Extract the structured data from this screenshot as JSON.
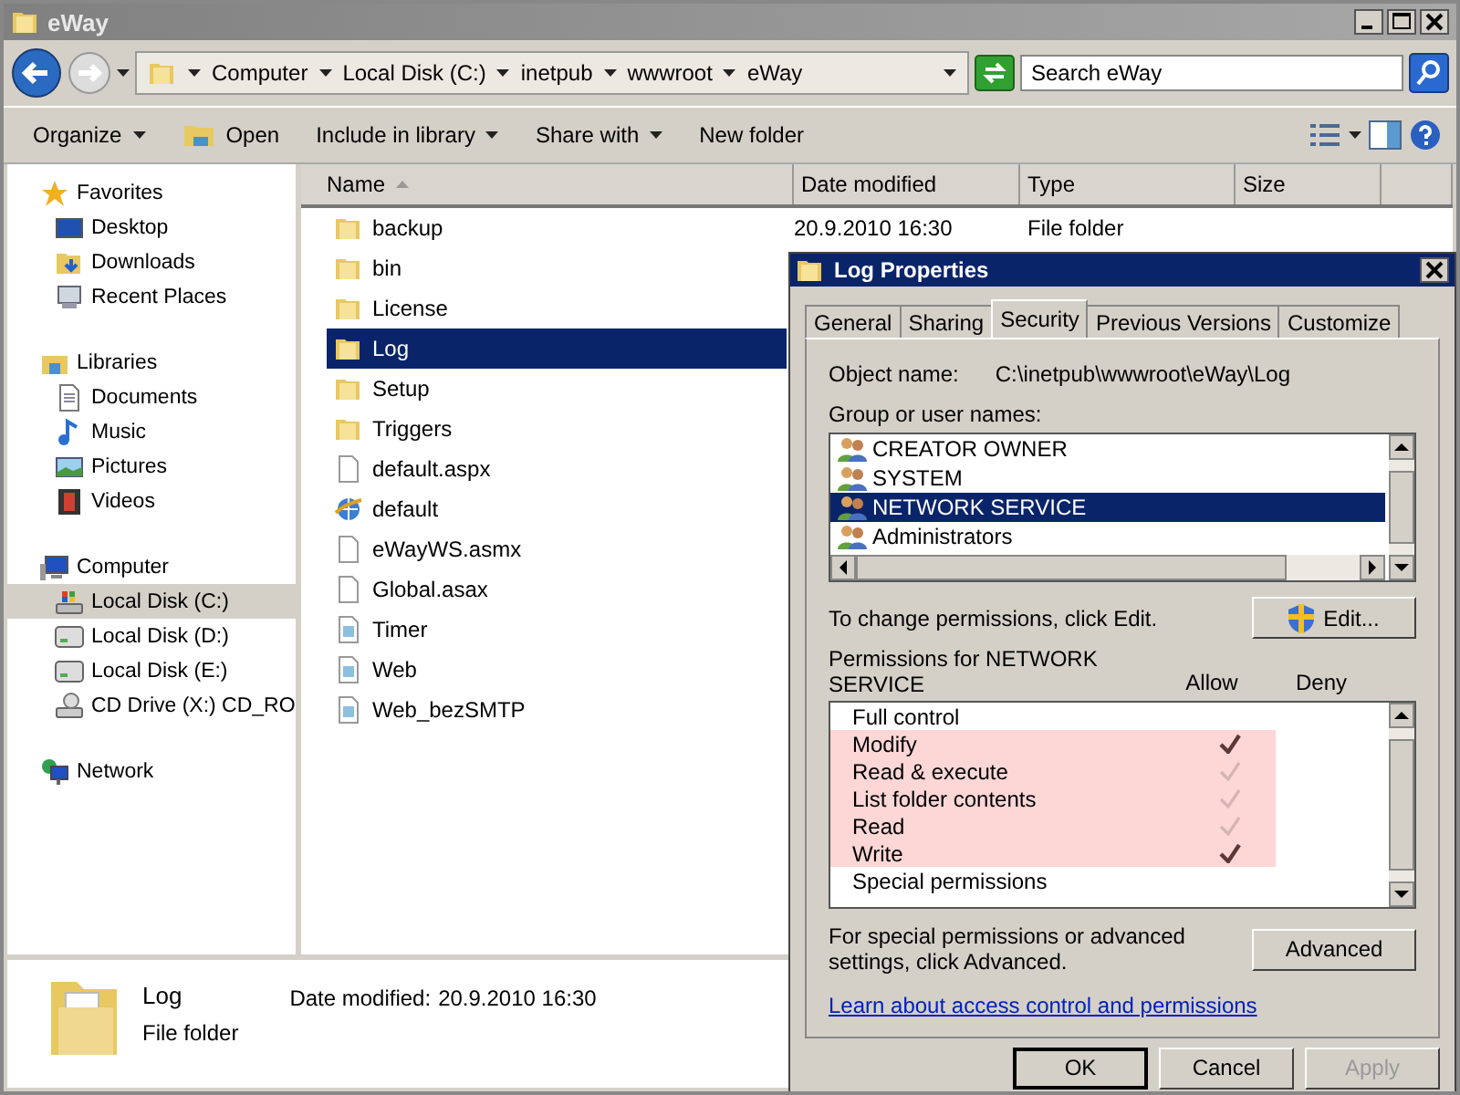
{
  "window": {
    "title": "eWay"
  },
  "address": {
    "segments": [
      "Computer",
      "Local Disk (C:)",
      "inetpub",
      "wwwroot",
      "eWay"
    ]
  },
  "search": {
    "placeholder": "Search eWay"
  },
  "toolbar": [
    {
      "label": "Organize",
      "kind": "menu"
    },
    {
      "label": "Open",
      "kind": "icon"
    },
    {
      "label": "Include in library",
      "kind": "menu"
    },
    {
      "label": "Share with",
      "kind": "menu"
    },
    {
      "label": "New folder",
      "kind": "plain"
    }
  ],
  "nav": [
    {
      "label": "Favorites",
      "kind": "star",
      "selected": false,
      "children": [
        {
          "label": "Desktop",
          "kind": "desktop",
          "selected": false
        },
        {
          "label": "Downloads",
          "kind": "downloads",
          "selected": false
        },
        {
          "label": "Recent Places",
          "kind": "recent",
          "selected": false
        }
      ]
    },
    {
      "label": "Libraries",
      "kind": "library",
      "selected": false,
      "children": [
        {
          "label": "Documents",
          "kind": "document",
          "selected": false
        },
        {
          "label": "Music",
          "kind": "music",
          "selected": false
        },
        {
          "label": "Pictures",
          "kind": "pictures",
          "selected": false
        },
        {
          "label": "Videos",
          "kind": "videos",
          "selected": false
        }
      ]
    },
    {
      "label": "Computer",
      "kind": "computer",
      "selected": false,
      "children": [
        {
          "label": "Local Disk (C:)",
          "kind": "sysdrive",
          "selected": true
        },
        {
          "label": "Local Disk (D:)",
          "kind": "drive",
          "selected": false
        },
        {
          "label": "Local Disk (E:)",
          "kind": "drive",
          "selected": false
        },
        {
          "label": "CD Drive (X:) CD_RO",
          "kind": "cd",
          "selected": false
        }
      ]
    },
    {
      "label": "Network",
      "kind": "network",
      "selected": false
    }
  ],
  "files": {
    "columns": [
      "Name",
      "Date modified",
      "Type",
      "Size"
    ],
    "rows": [
      {
        "name": "backup",
        "date": "20.9.2010 16:30",
        "type": "File folder",
        "kind": "folder",
        "selected": false
      },
      {
        "name": "bin",
        "kind": "folder",
        "selected": false
      },
      {
        "name": "License",
        "kind": "folder",
        "selected": false
      },
      {
        "name": "Log",
        "kind": "folder",
        "selected": true
      },
      {
        "name": "Setup",
        "kind": "folder",
        "selected": false
      },
      {
        "name": "Triggers",
        "kind": "folder",
        "selected": false
      },
      {
        "name": "default.aspx",
        "kind": "file",
        "selected": false
      },
      {
        "name": "default",
        "kind": "web",
        "selected": false
      },
      {
        "name": "eWayWS.asmx",
        "kind": "file",
        "selected": false
      },
      {
        "name": "Global.asax",
        "kind": "file",
        "selected": false
      },
      {
        "name": "Timer",
        "kind": "config",
        "selected": false
      },
      {
        "name": "Web",
        "kind": "config",
        "selected": false
      },
      {
        "name": "Web_bezSMTP",
        "kind": "config",
        "selected": false
      }
    ]
  },
  "details": {
    "name": "Log",
    "date_label": "Date modified:",
    "date": "20.9.2010 16:30",
    "type": "File folder"
  },
  "dialog": {
    "title": "Log Properties",
    "tabs": [
      {
        "label": "General",
        "selected": false
      },
      {
        "label": "Sharing",
        "selected": false
      },
      {
        "label": "Security",
        "selected": true
      },
      {
        "label": "Previous Versions",
        "selected": false
      },
      {
        "label": "Customize",
        "selected": false
      }
    ],
    "object_label": "Object name:",
    "object_name": "C:\\inetpub\\wwwroot\\eWay\\Log",
    "group_label": "Group or user names:",
    "users": [
      {
        "name": "CREATOR OWNER",
        "selected": false
      },
      {
        "name": "SYSTEM",
        "selected": false
      },
      {
        "name": "NETWORK SERVICE",
        "selected": true
      },
      {
        "name": "Administrators",
        "selected": false
      }
    ],
    "edit_note": "To change permissions, click Edit.",
    "edit_button": "Edit...",
    "permissions_label": "Permissions for NETWORK SERVICE",
    "allow_header": "Allow",
    "deny_header": "Deny",
    "permissions": [
      {
        "name": "Full control",
        "allowed": false,
        "highlighted": false
      },
      {
        "name": "Modify",
        "allowed": true,
        "inherited": false,
        "highlighted": true
      },
      {
        "name": "Read & execute",
        "allowed": true,
        "inherited": true,
        "highlighted": true
      },
      {
        "name": "List folder contents",
        "allowed": true,
        "inherited": true,
        "highlighted": true
      },
      {
        "name": "Read",
        "allowed": true,
        "inherited": true,
        "highlighted": true
      },
      {
        "name": "Write",
        "allowed": true,
        "inherited": false,
        "highlighted": true
      },
      {
        "name": "Special permissions",
        "allowed": false,
        "highlighted": false
      }
    ],
    "advanced_note": "For special permissions or advanced settings, click Advanced.",
    "advanced_button": "Advanced",
    "link": "Learn about access control and permissions",
    "buttons": [
      {
        "label": "OK",
        "default": true,
        "disabled": false
      },
      {
        "label": "Cancel",
        "default": false,
        "disabled": false
      },
      {
        "label": "Apply",
        "default": false,
        "disabled": true
      }
    ]
  }
}
